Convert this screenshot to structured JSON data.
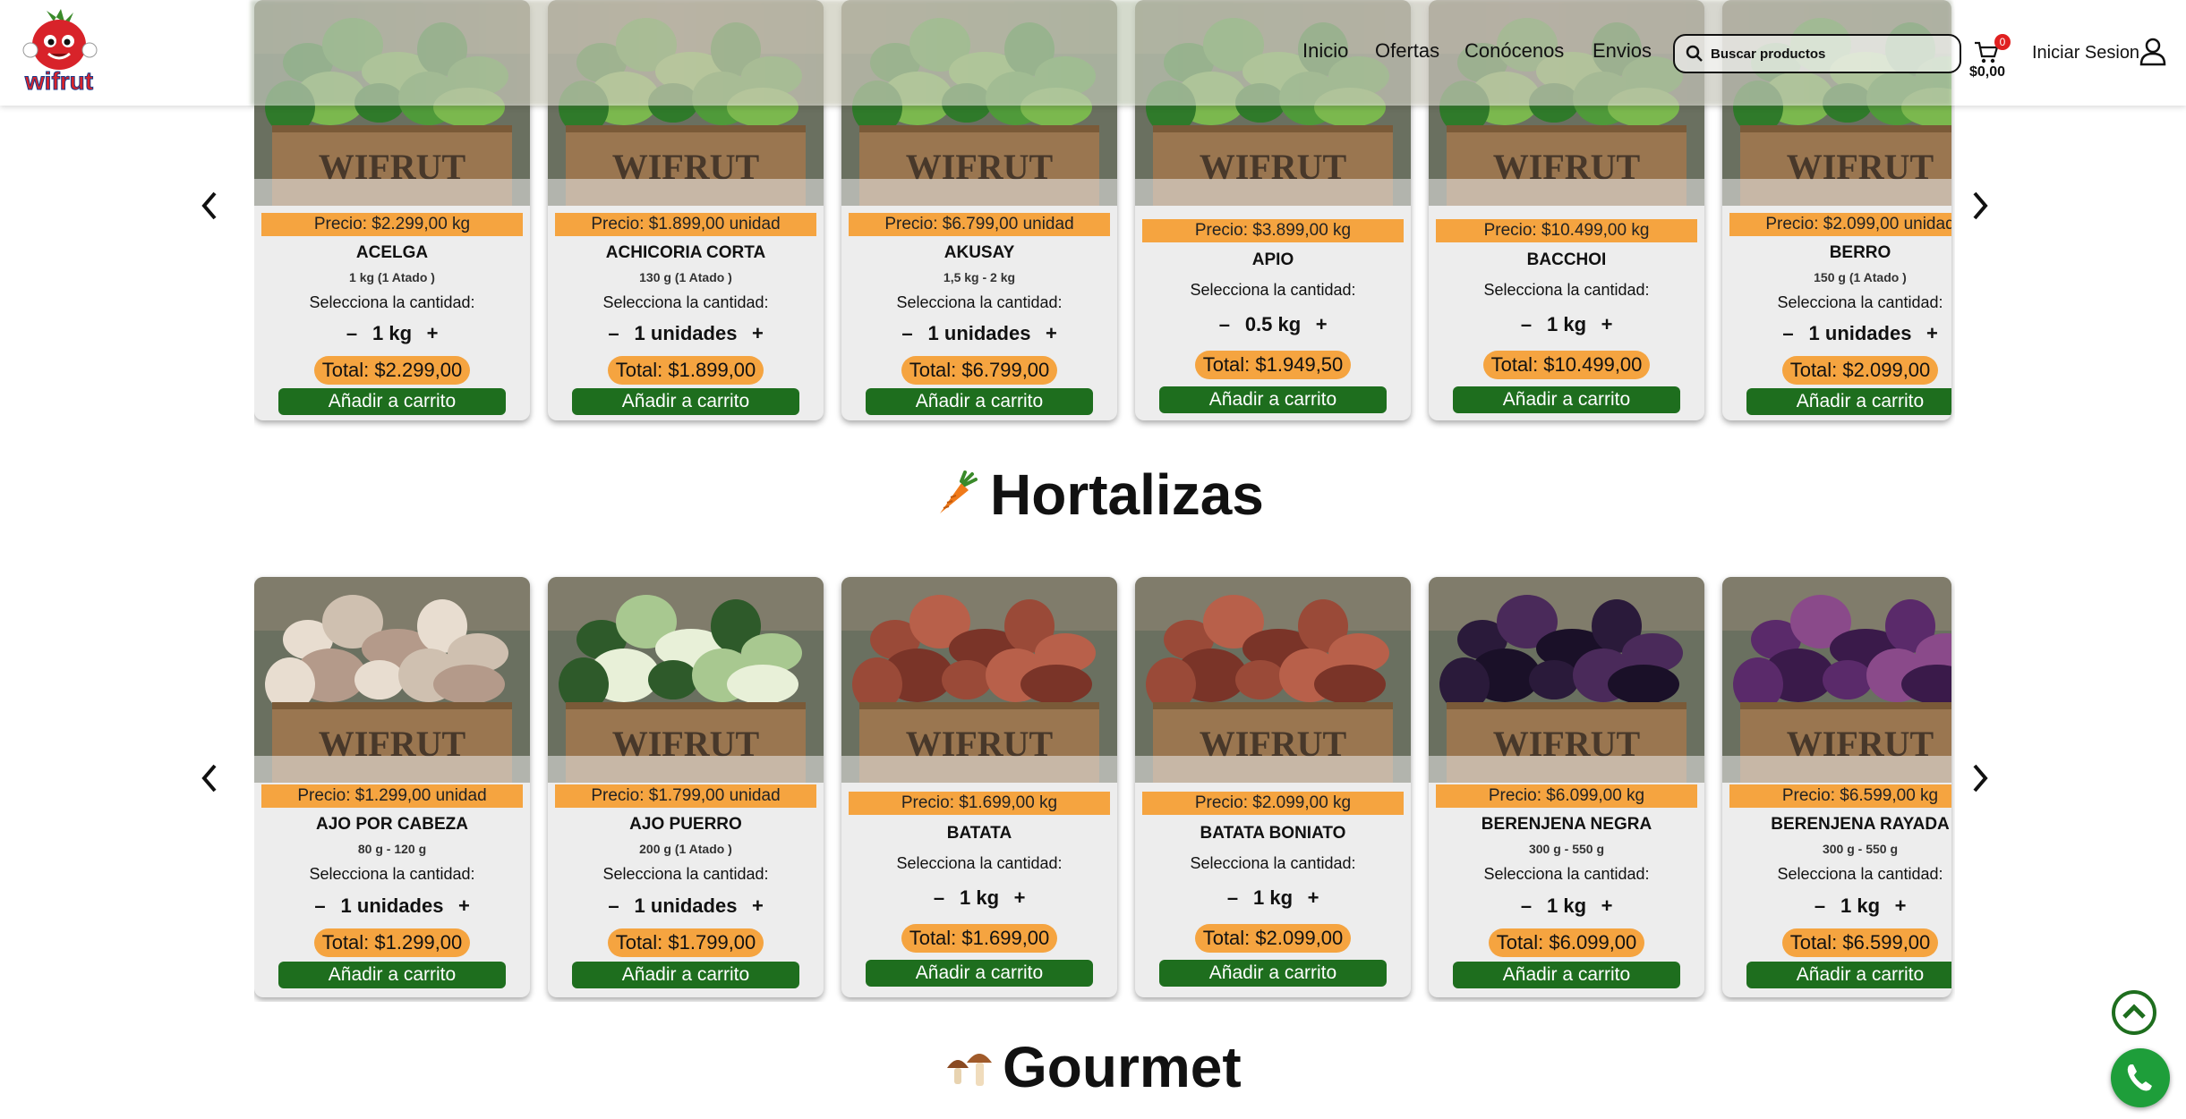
{
  "header": {
    "logo_text": "wifrut",
    "nav": [
      "Inicio",
      "Ofertas",
      "Conócenos",
      "Envios"
    ],
    "search_placeholder": "Buscar productos",
    "cart_count": "0",
    "cart_total": "$0,00",
    "login_label": "Iniciar Sesion"
  },
  "select_label": "Selecciona la cantidad:",
  "add_label": "Añadir a carrito",
  "top_row": [
    {
      "price": "Precio: $2.299,00 kg",
      "name": "ACELGA",
      "weight": "1 kg (1 Atado )",
      "qty": "1 kg",
      "total": "Total: $2.299,00"
    },
    {
      "price": "Precio: $1.899,00 unidad",
      "name": "ACHICORIA CORTA",
      "weight": "130 g (1 Atado )",
      "qty": "1 unidades",
      "total": "Total: $1.899,00"
    },
    {
      "price": "Precio: $6.799,00 unidad",
      "name": "AKUSAY",
      "weight": "1,5 kg - 2 kg",
      "qty": "1 unidades",
      "total": "Total: $6.799,00"
    },
    {
      "price": "Precio: $3.899,00 kg",
      "name": "APIO",
      "weight": "",
      "qty": "0.5 kg",
      "total": "Total: $1.949,50"
    },
    {
      "price": "Precio: $10.499,00 kg",
      "name": "BACCHOI",
      "weight": "",
      "qty": "1 kg",
      "total": "Total: $10.499,00"
    },
    {
      "price": "Precio: $2.099,00 unidad",
      "name": "BERRO",
      "weight": "150 g (1 Atado )",
      "qty": "1 unidades",
      "total": "Total: $2.099,00"
    }
  ],
  "sections": {
    "hortalizas_title": "Hortalizas",
    "gourmet_title": "Gourmet"
  },
  "hortalizas": [
    {
      "price": "Precio: $1.299,00 unidad",
      "name": "AJO POR CABEZA",
      "weight": "80 g - 120 g",
      "qty": "1 unidades",
      "total": "Total: $1.299,00"
    },
    {
      "price": "Precio: $1.799,00 unidad",
      "name": "AJO PUERRO",
      "weight": "200 g (1 Atado )",
      "qty": "1 unidades",
      "total": "Total: $1.799,00"
    },
    {
      "price": "Precio: $1.699,00 kg",
      "name": "BATATA",
      "weight": "",
      "qty": "1 kg",
      "total": "Total: $1.699,00"
    },
    {
      "price": "Precio: $2.099,00 kg",
      "name": "BATATA BONIATO",
      "weight": "",
      "qty": "1 kg",
      "total": "Total: $2.099,00"
    },
    {
      "price": "Precio: $6.099,00 kg",
      "name": "BERENJENA NEGRA",
      "weight": "300 g - 550 g",
      "qty": "1 kg",
      "total": "Total: $6.099,00"
    },
    {
      "price": "Precio: $6.599,00 kg",
      "name": "BERENJENA RAYADA",
      "weight": "300 g - 550 g",
      "qty": "1 kg",
      "total": "Total: $6.599,00"
    }
  ],
  "crate_text": "WIFRUT",
  "colors": {
    "accent_orange": "#f5a440",
    "button_green": "#1e6e1e",
    "whatsapp_green": "#1e9e3a"
  }
}
